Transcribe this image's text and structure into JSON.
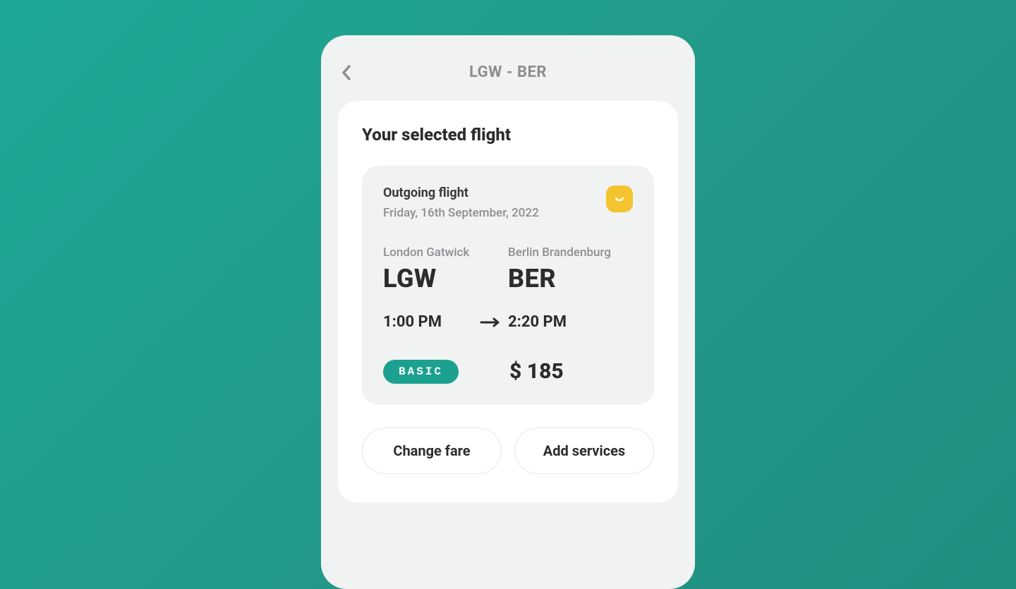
{
  "header": {
    "title": "LGW - BER"
  },
  "card": {
    "title": "Your selected flight"
  },
  "flight": {
    "label": "Outgoing flight",
    "date": "Friday, 16th September, 2022",
    "origin": {
      "name": "London Gatwick",
      "code": "LGW",
      "time": "1:00 PM"
    },
    "destination": {
      "name": "Berlin Brandenburg",
      "code": "BER",
      "time": "2:20 PM"
    },
    "fare": "BASIC",
    "price": "$ 185"
  },
  "actions": {
    "change_fare": "Change fare",
    "add_services": "Add services"
  }
}
